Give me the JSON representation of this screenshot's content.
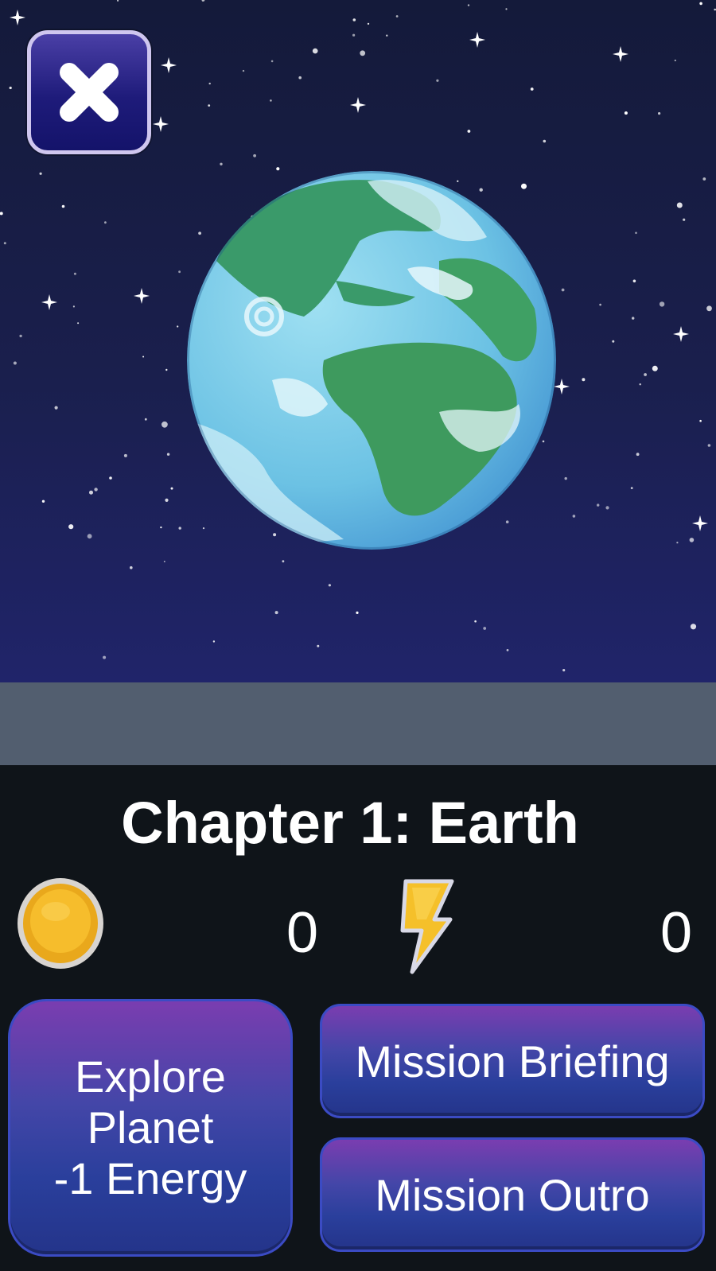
{
  "screen": {
    "chapter_title": "Chapter 1: Earth",
    "planet": "Earth"
  },
  "icons": {
    "close": "close-x-icon",
    "coin": "gold-coin-icon",
    "energy": "lightning-bolt-icon"
  },
  "resources": {
    "coins": "0",
    "energy": "0"
  },
  "buttons": {
    "explore_line1": "Explore",
    "explore_line2": "Planet",
    "explore_line3": "-1 Energy",
    "briefing": "Mission Briefing",
    "outro": "Mission Outro"
  },
  "colors": {
    "space_bg": "#1a1f4d",
    "panel_bg": "#0f1419",
    "divider": "#525e6f",
    "button_top": "#7a3db0",
    "button_bottom": "#24348a",
    "coin": "#f2b81f",
    "energy": "#f5c02a"
  }
}
